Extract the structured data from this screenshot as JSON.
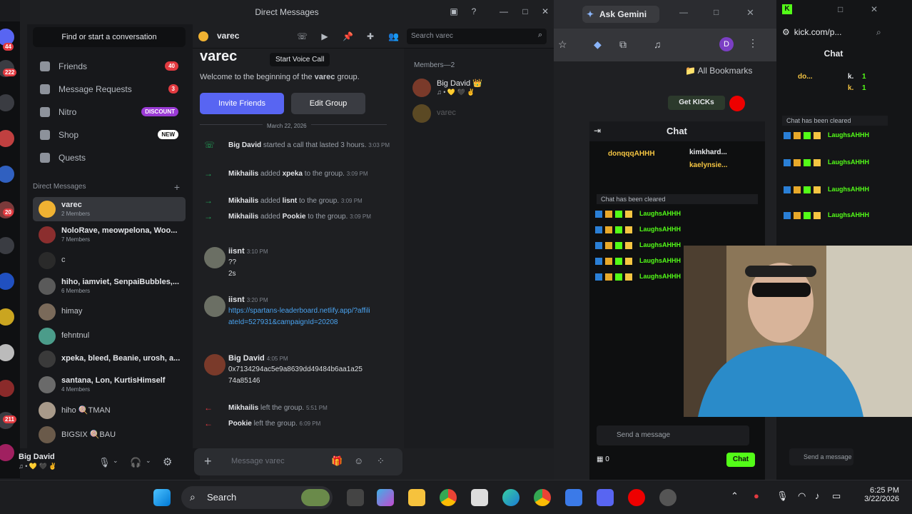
{
  "discord": {
    "window_title": "Direct Messages",
    "search_conversation": "Find or start a conversation",
    "nav": [
      {
        "label": "Friends",
        "badge": "40",
        "badge_color": "#e23a40"
      },
      {
        "label": "Message Requests",
        "badge": "3",
        "badge_color": "#e23a40"
      },
      {
        "label": "Nitro",
        "badge": "DISCOUNT",
        "badge_color": "#9b3bd6"
      },
      {
        "label": "Shop",
        "badge": "NEW",
        "badge_color": "#ffffff"
      },
      {
        "label": "Quests",
        "badge": "",
        "badge_color": ""
      }
    ],
    "dm_header": "Direct Messages",
    "dms": [
      {
        "name": "varec",
        "sub": "2 Members",
        "color": "#f0b232"
      },
      {
        "name": "NoloRave, meowpelona, Woo...",
        "sub": "7 Members",
        "color": "#8b2e2e"
      },
      {
        "name": "c",
        "sub": "",
        "color": "#2a2a2a"
      },
      {
        "name": "hiho, iamviet, SenpaiBubbles,...",
        "sub": "6 Members",
        "color": "#5a5a5a"
      },
      {
        "name": "himay",
        "sub": "",
        "color": "#7a6a5a"
      },
      {
        "name": "fehntnul",
        "sub": "",
        "color": "#4b9c8a"
      },
      {
        "name": "xpeka, bleed, Beanie, urosh, a...",
        "sub": "",
        "color": "#3a3a3a"
      },
      {
        "name": "santana, Lon, KurtisHimself",
        "sub": "4 Members",
        "color": "#6a6a6a"
      },
      {
        "name": "hiho 🍭TMAN",
        "sub": "",
        "color": "#a89a8a"
      },
      {
        "name": "BIGSIX 🍭BAU",
        "sub": "",
        "color": "#6a5a4a"
      }
    ],
    "user": {
      "name": "Big David",
      "status": "♫ • 💛 🖤 ✌"
    },
    "channel": {
      "name": "varec",
      "search_placeholder": "Search varec",
      "tooltip": "Start Voice Call"
    },
    "intro": {
      "title": "varec",
      "welcome_pre": "Welcome to the beginning of the ",
      "welcome_name": "varec",
      "welcome_post": " group.",
      "invite_button": "Invite Friends",
      "edit_button": "Edit Group"
    },
    "date_divider": "March 22, 2026",
    "system_messages": [
      {
        "icon": "call",
        "author": "Big David",
        "text": " started a call that lasted 3 hours.",
        "time": "3:03 PM"
      },
      {
        "icon": "join",
        "author": "Mikhailis",
        "text": " added ",
        "target": "xpeka",
        "tail": " to the group.",
        "time": "3:09 PM"
      },
      {
        "icon": "join",
        "author": "Mikhailis",
        "text": " added ",
        "target": "lisnt",
        "tail": " to the group.",
        "time": "3:09 PM"
      },
      {
        "icon": "join",
        "author": "Mikhailis",
        "text": " added ",
        "target": "Pookie",
        "tail": " to the group.",
        "time": "3:09 PM"
      }
    ],
    "messages": [
      {
        "author": "iisnt",
        "time": "3:10 PM",
        "lines": [
          "??",
          "2s"
        ]
      },
      {
        "author": "iisnt",
        "time": "3:20 PM",
        "link": "https://spartans-leaderboard.netlify.app/?affiliateId=527931&campaignId=20208"
      },
      {
        "author": "Big David",
        "time": "4:05 PM",
        "lines": [
          "0x7134294ac5e9a8639dd49484b6aa1a25",
          "74a85146"
        ]
      }
    ],
    "leave_messages": [
      {
        "author": "Mikhailis",
        "text": " left the group.",
        "time": "5:51 PM"
      },
      {
        "author": "Pookie",
        "text": " left the group.",
        "time": "6:09 PM"
      }
    ],
    "members_header": "Members—2",
    "members": [
      {
        "name": "Big David 👑",
        "status": "♫ • 💛 🖤 ✌"
      },
      {
        "name": "varec",
        "status": ""
      }
    ],
    "composer_placeholder": "Message varec"
  },
  "chrome": {
    "tab": "Ask Gemini",
    "bookmarks": "All Bookmarks",
    "get_kicks": "Get KICKs",
    "chat_title": "Chat",
    "top_users": [
      "donqqqAHHH",
      "kimkhard...",
      "kaelynsie..."
    ],
    "cleared": "Chat has been cleared",
    "chat_user": "LaughsAHHH",
    "send_placeholder": "Send a message",
    "points": "0",
    "chat_button": "Chat"
  },
  "kick": {
    "url": "kick.com/p...",
    "chat_title": "Chat",
    "top_users": [
      "do...",
      "k.",
      "k."
    ],
    "top_counts": [
      "1",
      "1",
      "1"
    ],
    "cleared": "Chat has been cleared",
    "chat_user": "LaughsAHHH",
    "send_placeholder": "Send a message"
  },
  "taskbar": {
    "search": "Search",
    "time": "6:25 PM",
    "date": "3/22/2026"
  }
}
